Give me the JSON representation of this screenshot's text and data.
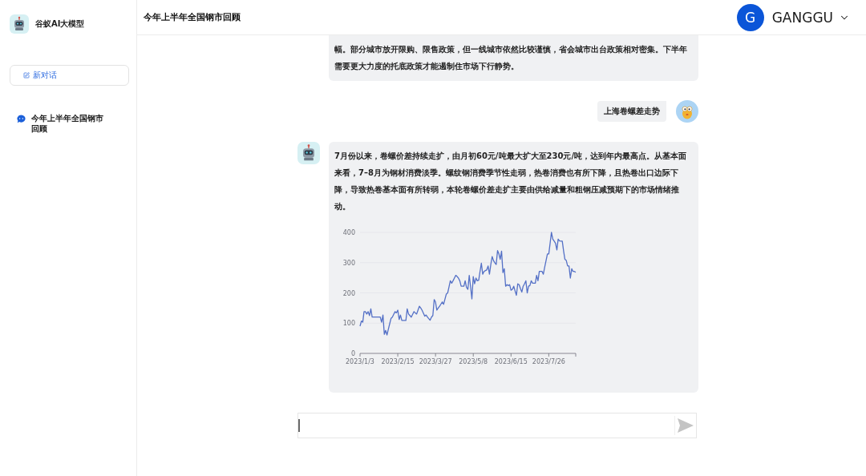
{
  "sidebar": {
    "app_name": "谷蚁AI大模型",
    "new_chat_button": "新对话",
    "conversations": [
      {
        "title": "今年上半年全国钢市回顾"
      }
    ]
  },
  "header": {
    "title": "今年上半年全国钢市回顾",
    "user": {
      "initial": "G",
      "name": "GANGGU"
    }
  },
  "messages": [
    {
      "kind": "bot",
      "cut_top": true,
      "text": "幅。部分城市放开限购、限售政策，但一线城市依然比较谨慎，省会城市出台政策相对密集。下半年需要更大力度的托底政策才能遏制住市场下行静势。"
    },
    {
      "kind": "user",
      "text": "上海卷螺差走势"
    },
    {
      "kind": "bot",
      "cut_top": false,
      "text": "7月份以来，卷螺价差持续走扩，由月初60元/吨最大扩大至230元/吨，达到年内最高点。从基本面来看，7–8月为钢材消费淡季。螺纹钢消费季节性走弱，热卷消费也有所下降，且热卷出口边际下降，导致热卷基本面有所转弱，本轮卷螺价差走扩主要由供给减量和粗钢压减预期下的市场情绪推动。",
      "chart_data": {
        "type": "line",
        "grid": true,
        "categories": [
          "2023/1/3",
          null,
          null,
          null,
          null,
          null,
          null,
          null,
          null,
          null,
          null,
          null,
          null,
          null,
          null,
          null,
          null,
          null,
          null,
          null,
          null,
          null,
          null,
          null,
          null,
          null,
          null,
          null,
          "2023/2/15",
          null,
          null,
          null,
          null,
          null,
          null,
          null,
          null,
          null,
          null,
          null,
          null,
          null,
          null,
          null,
          null,
          null,
          null,
          null,
          null,
          null,
          null,
          null,
          null,
          null,
          null,
          null,
          "2023/3/27",
          null,
          null,
          null,
          null,
          null,
          null,
          null,
          null,
          null,
          null,
          null,
          null,
          null,
          null,
          null,
          null,
          null,
          null,
          null,
          null,
          null,
          null,
          null,
          null,
          null,
          null,
          null,
          "2023/5/8",
          null,
          null,
          null,
          null,
          null,
          null,
          null,
          null,
          null,
          null,
          null,
          null,
          null,
          null,
          null,
          null,
          null,
          null,
          null,
          null,
          null,
          null,
          null,
          null,
          null,
          null,
          null,
          "2023/6/15",
          null,
          null,
          null,
          null,
          null,
          null,
          null,
          null,
          null,
          null,
          null,
          null,
          null,
          null,
          null,
          null,
          null,
          null,
          null,
          null,
          null,
          null,
          null,
          null,
          null,
          null,
          null,
          "2023/7/26",
          null,
          null,
          null,
          null,
          null,
          null,
          null,
          null,
          null,
          null,
          null,
          null,
          null,
          null,
          null,
          null,
          null,
          null,
          null,
          null
        ],
        "series": [
          {
            "color": "#5470c6",
            "values": [
              90,
              107,
              103,
              138,
              138,
              130,
              138,
              125,
              147,
              120,
              120,
              120,
              120,
              120,
              120,
              120,
              103,
              127,
              63,
              76,
              61,
              80,
              98,
              116,
              120,
              129,
              138,
              134,
              143,
              112,
              127,
              109,
              109,
              109,
              109,
              147,
              130,
              125,
              120,
              129,
              138,
              134,
              130,
              143,
              156,
              150,
              143,
              133,
              123,
              127,
              120,
              115,
              110,
              120,
              125,
              178,
              170,
              143,
              150,
              156,
              163,
              170,
              162,
              179,
              196,
              200,
              220,
              240,
              232,
              240,
              249,
              258,
              254,
              249,
              240,
              222,
              222,
              222,
              240,
              218,
              212,
              258,
              219,
              180,
              254,
              230,
              249,
              240,
              242,
              270,
              298,
              262,
              271,
              274,
              276,
              289,
              262,
              294,
              320,
              307,
              300,
              294,
              340,
              329,
              311,
              338,
              267,
              280,
              222,
              227,
              224,
              227,
              209,
              212,
              222,
              207,
              192,
              230,
              227,
              214,
              203,
              222,
              230,
              240,
              200,
              222,
              224,
              240,
              232,
              232,
              232,
              258,
              240,
              271,
              271,
              271,
              262,
              285,
              307,
              329,
              329,
              365,
              400,
              378,
              371,
              364,
              342,
              378,
              372,
              371,
              371,
              338,
              311,
              307,
              289,
              289,
              249,
              280,
              271,
              271,
              268
            ]
          }
        ],
        "ylim": [
          0,
          400
        ],
        "yticks": [
          0,
          100,
          200,
          300,
          400
        ]
      }
    }
  ]
}
